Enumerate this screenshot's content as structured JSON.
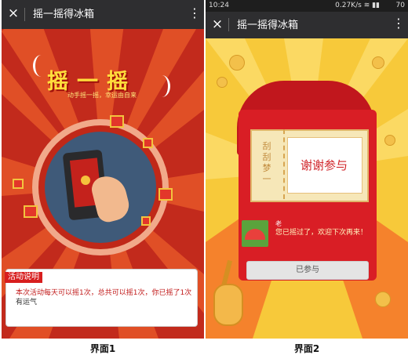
{
  "screen1": {
    "header": {
      "close_icon": "×",
      "title": "摇一摇得冰箱",
      "more_icon": "⋮"
    },
    "shake_title": "摇一摇",
    "shake_subtitle": "动手摇一摇，幸运由自来",
    "notice": {
      "tag": "活动说明",
      "body": "本次活动每天可以摇1次，总共可以摇1次，你已摇了1次",
      "tail": "有运气"
    },
    "caption": "界面1"
  },
  "screen2": {
    "status_bar": {
      "time": "10:24",
      "network": "0.27K/s",
      "signal_icons": "≋ ▮▮",
      "battery": "70"
    },
    "header": {
      "close_icon": "×",
      "title": "摇一摇得冰箱",
      "more_icon": "⋮"
    },
    "ticket": {
      "stub": "刮刮梦一",
      "main": "谢谢参与"
    },
    "message": {
      "name": "老",
      "body": "您已摇过了，欢迎下次再来！"
    },
    "button": "已参与",
    "caption": "界面2"
  },
  "colors": {
    "screen1_bg": "#c22a1c",
    "screen2_bg": "#f4b515",
    "header": "#2e2e30",
    "envelope": "#d91e25"
  }
}
